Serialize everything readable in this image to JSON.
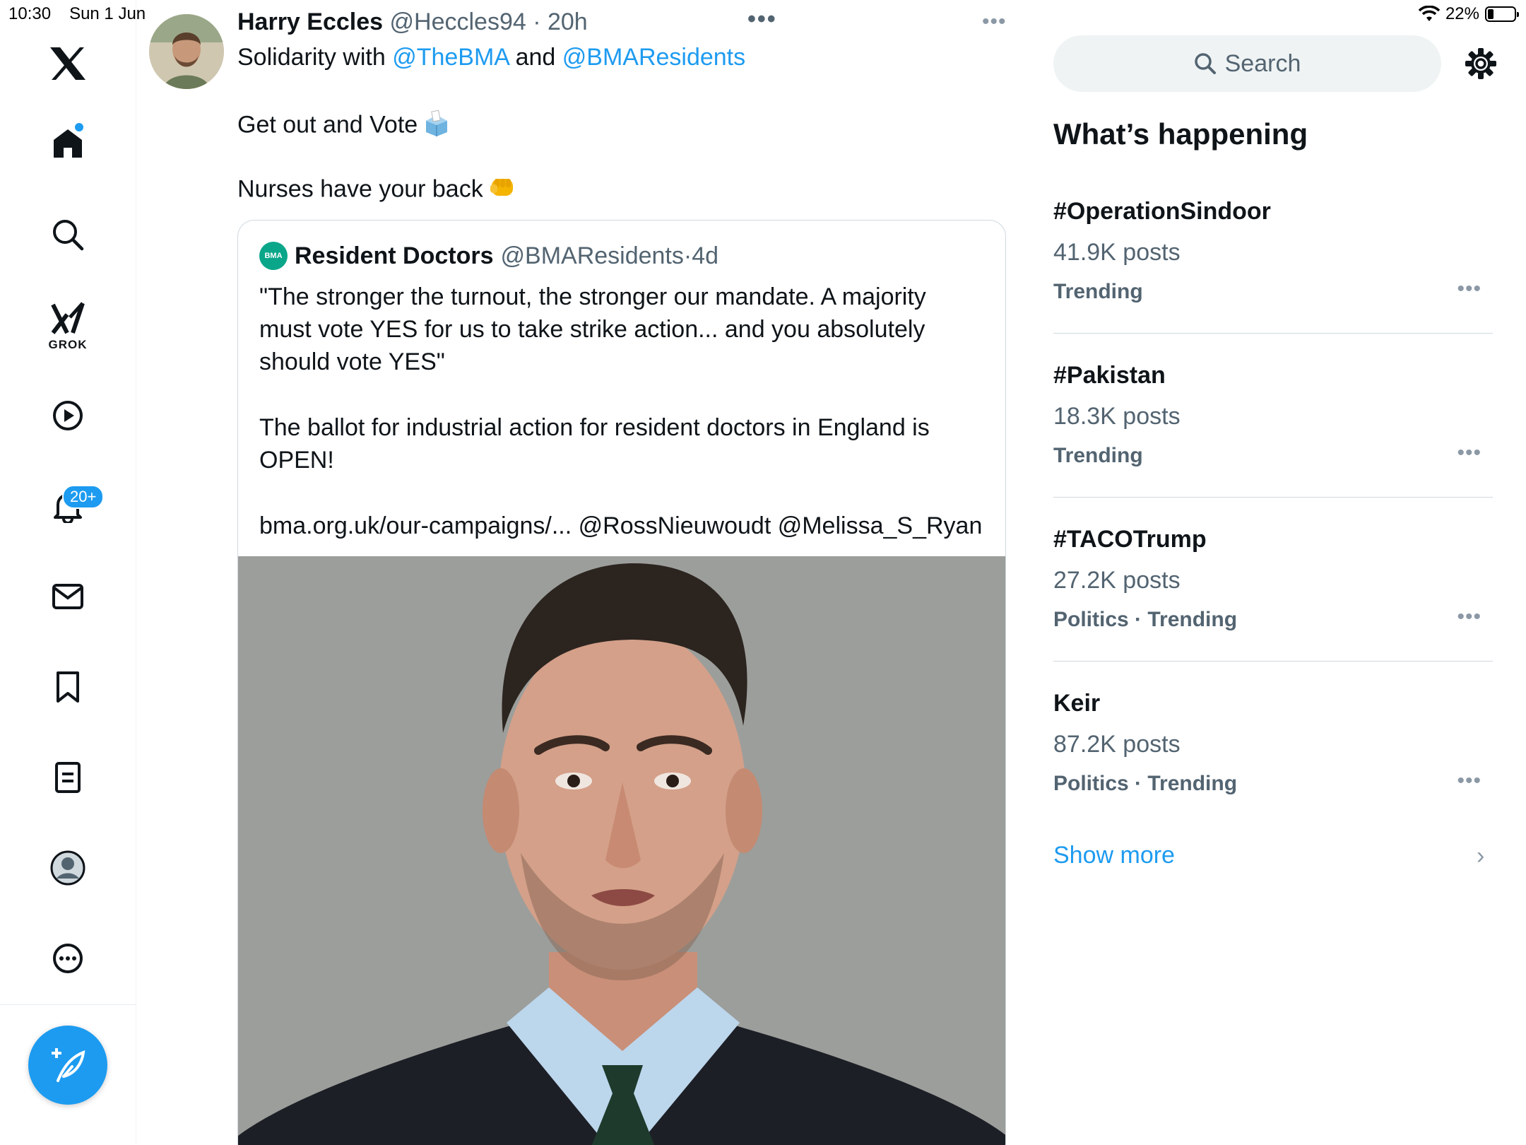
{
  "status_bar": {
    "time": "10:30",
    "date": "Sun 1 Jun",
    "battery": "22%",
    "battery_level": 0.22
  },
  "nav": {
    "notifications_badge": "20+",
    "grok_label": "GROK"
  },
  "tweet": {
    "author_name": "Harry Eccles",
    "author_handle": "@Heccles94",
    "time": "20h",
    "line1_prefix": "Solidarity with",
    "mention1": "@TheBMA",
    "line1_and": "and",
    "mention2": "@BMAResidents",
    "line2": "Get out and Vote",
    "line3": "Nurses have your back",
    "quote": {
      "avatar_text": "BMA",
      "author_name": "Resident Doctors",
      "author_handle": "@BMAResidents",
      "time": "4d",
      "lines": [
        "\"The stronger the turnout, the stronger our mandate. A majority",
        "must vote YES for us to take strike action... and you absolutely",
        "should vote YES\"",
        "The ballot for industrial action for resident doctors in England is",
        "OPEN!",
        "bma.org.uk/our-campaigns/... @RossNieuwoudt @Melissa_S_Ryan"
      ]
    }
  },
  "sidebar": {
    "search_placeholder": "Search",
    "heading": "What’s happening",
    "trends": [
      {
        "tag": "#OperationSindoor",
        "count": "41.9K posts",
        "context": "Trending"
      },
      {
        "tag": "#Pakistan",
        "count": "18.3K posts",
        "context": "Trending"
      },
      {
        "tag": "#TACOTrump",
        "count": "27.2K posts",
        "context": "Politics · Trending"
      },
      {
        "tag": "Keir",
        "count": "87.2K posts",
        "context": "Politics · Trending"
      }
    ],
    "show_more": "Show more"
  }
}
